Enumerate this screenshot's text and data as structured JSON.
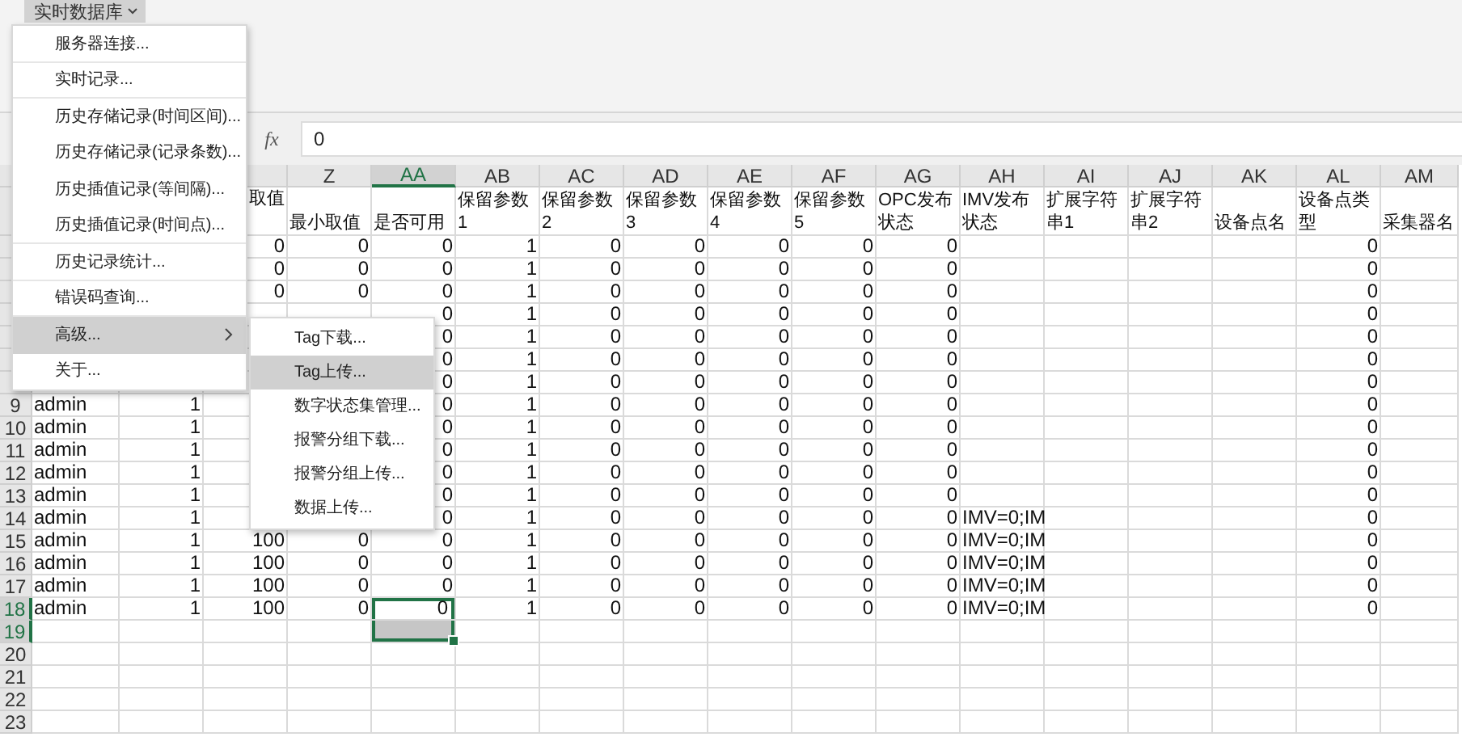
{
  "toolbar": {
    "menu_button": "实时数据库"
  },
  "formula_bar": {
    "fx_label": "fx",
    "value": "0"
  },
  "sheet": {
    "column_headers": [
      {
        "letter": "Z",
        "selected": false
      },
      {
        "letter": "AA",
        "selected": true
      },
      {
        "letter": "AB",
        "selected": false
      },
      {
        "letter": "AC",
        "selected": false
      },
      {
        "letter": "AD",
        "selected": false
      },
      {
        "letter": "AE",
        "selected": false
      },
      {
        "letter": "AF",
        "selected": false
      },
      {
        "letter": "AG",
        "selected": false
      },
      {
        "letter": "AH",
        "selected": false
      },
      {
        "letter": "AI",
        "selected": false
      },
      {
        "letter": "AJ",
        "selected": false
      },
      {
        "letter": "AK",
        "selected": false
      },
      {
        "letter": "AL",
        "selected": false
      },
      {
        "letter": "AM",
        "selected": false
      }
    ],
    "rows": [
      {
        "kind": "header",
        "selected": false,
        "cells": [
          null,
          null,
          "取值",
          "最小取值",
          "是否可用",
          "保留参数1",
          "保留参数2",
          "保留参数3",
          "保留参数4",
          "保留参数5",
          "OPC发布状态",
          "IMV发布状态",
          "扩展字符串1",
          "扩展字符串2",
          "设备点名",
          "设备点类型",
          "采集器名"
        ]
      },
      {
        "kind": "data",
        "selected": false,
        "cells": [
          null,
          null,
          "0",
          "0",
          "0",
          "1",
          "0",
          "0",
          "0",
          "0",
          "0",
          null,
          null,
          null,
          null,
          "0",
          null
        ]
      },
      {
        "kind": "data",
        "selected": false,
        "cells": [
          null,
          null,
          "0",
          "0",
          "0",
          "1",
          "0",
          "0",
          "0",
          "0",
          "0",
          null,
          null,
          null,
          null,
          "0",
          null
        ]
      },
      {
        "kind": "data",
        "selected": false,
        "cells": [
          null,
          null,
          "0",
          "0",
          "0",
          "1",
          "0",
          "0",
          "0",
          "0",
          "0",
          null,
          null,
          null,
          null,
          "0",
          null
        ]
      },
      {
        "kind": "data",
        "selected": false,
        "cells": [
          null,
          null,
          null,
          null,
          "0",
          "1",
          "0",
          "0",
          "0",
          "0",
          "0",
          null,
          null,
          null,
          null,
          "0",
          null
        ]
      },
      {
        "kind": "data",
        "selected": false,
        "cells": [
          null,
          null,
          null,
          null,
          "0",
          "1",
          "0",
          "0",
          "0",
          "0",
          "0",
          null,
          null,
          null,
          null,
          "0",
          null
        ]
      },
      {
        "kind": "data",
        "selected": false,
        "cells": [
          null,
          null,
          null,
          null,
          "0",
          "1",
          "0",
          "0",
          "0",
          "0",
          "0",
          null,
          null,
          null,
          null,
          "0",
          null
        ]
      },
      {
        "kind": "data",
        "selected": false,
        "cells": [
          null,
          null,
          null,
          null,
          "0",
          "1",
          "0",
          "0",
          "0",
          "0",
          "0",
          null,
          null,
          null,
          null,
          "0",
          null
        ]
      },
      {
        "kind": "data",
        "number": "9",
        "selected": false,
        "cells": [
          "admin",
          "1",
          null,
          null,
          "0",
          "1",
          "0",
          "0",
          "0",
          "0",
          "0",
          null,
          null,
          null,
          null,
          "0",
          null
        ]
      },
      {
        "kind": "data",
        "number": "10",
        "selected": false,
        "cells": [
          "admin",
          "1",
          null,
          null,
          "0",
          "1",
          "0",
          "0",
          "0",
          "0",
          "0",
          null,
          null,
          null,
          null,
          "0",
          null
        ]
      },
      {
        "kind": "data",
        "number": "11",
        "selected": false,
        "cells": [
          "admin",
          "1",
          null,
          null,
          "0",
          "1",
          "0",
          "0",
          "0",
          "0",
          "0",
          null,
          null,
          null,
          null,
          "0",
          null
        ]
      },
      {
        "kind": "data",
        "number": "12",
        "selected": false,
        "cells": [
          "admin",
          "1",
          null,
          null,
          "0",
          "1",
          "0",
          "0",
          "0",
          "0",
          "0",
          null,
          null,
          null,
          null,
          "0",
          null
        ]
      },
      {
        "kind": "data",
        "number": "13",
        "selected": false,
        "cells": [
          "admin",
          "1",
          null,
          null,
          "0",
          "1",
          "0",
          "0",
          "0",
          "0",
          "0",
          null,
          null,
          null,
          null,
          "0",
          null
        ]
      },
      {
        "kind": "data",
        "number": "14",
        "selected": false,
        "cells": [
          "admin",
          "1",
          null,
          null,
          "0",
          "1",
          "0",
          "0",
          "0",
          "0",
          "0",
          "IMV=0;IM",
          null,
          null,
          null,
          "0",
          null
        ]
      },
      {
        "kind": "data",
        "number": "15",
        "selected": false,
        "cells": [
          "admin",
          "1",
          "100",
          "0",
          "0",
          "1",
          "0",
          "0",
          "0",
          "0",
          "0",
          "IMV=0;IM",
          null,
          null,
          null,
          "0",
          null
        ]
      },
      {
        "kind": "data",
        "number": "16",
        "selected": false,
        "cells": [
          "admin",
          "1",
          "100",
          "0",
          "0",
          "1",
          "0",
          "0",
          "0",
          "0",
          "0",
          "IMV=0;IM",
          null,
          null,
          null,
          "0",
          null
        ]
      },
      {
        "kind": "data",
        "number": "17",
        "selected": false,
        "cells": [
          "admin",
          "1",
          "100",
          "0",
          "0",
          "1",
          "0",
          "0",
          "0",
          "0",
          "0",
          "IMV=0;IM",
          null,
          null,
          null,
          "0",
          null
        ]
      },
      {
        "kind": "data",
        "number": "18",
        "selected": true,
        "cells": [
          "admin",
          "1",
          "100",
          "0",
          "0",
          "1",
          "0",
          "0",
          "0",
          "0",
          "0",
          "IMV=0;IM",
          null,
          null,
          null,
          "0",
          null
        ]
      },
      {
        "kind": "data",
        "number": "19",
        "selected": true
      },
      {
        "kind": "data",
        "number": "20",
        "selected": false
      },
      {
        "kind": "data",
        "number": "21",
        "selected": false
      },
      {
        "kind": "data",
        "number": "22",
        "selected": false
      },
      {
        "kind": "data",
        "number": "23",
        "selected": false
      }
    ]
  },
  "menu": {
    "items": [
      {
        "label": "服务器连接...",
        "highlighted": false,
        "separator_after": true
      },
      {
        "label": "实时记录...",
        "highlighted": false,
        "separator_after": true
      },
      {
        "label": "历史存储记录(时间区间)...",
        "highlighted": false,
        "separator_after": false
      },
      {
        "label": "历史存储记录(记录条数)...",
        "highlighted": false,
        "separator_after": false
      },
      {
        "label": "历史插值记录(等间隔)...",
        "highlighted": false,
        "separator_after": false
      },
      {
        "label": "历史插值记录(时间点)...",
        "highlighted": false,
        "separator_after": true
      },
      {
        "label": "历史记录统计...",
        "highlighted": false,
        "separator_after": true
      },
      {
        "label": "错误码查询...",
        "highlighted": false,
        "separator_after": true
      },
      {
        "label": "高级...",
        "highlighted": true,
        "has_submenu": true,
        "separator_after": false
      },
      {
        "label": "关于...",
        "highlighted": false,
        "separator_after": false
      }
    ]
  },
  "submenu": {
    "items": [
      {
        "label": "Tag下载...",
        "highlighted": false
      },
      {
        "label": "Tag上传...",
        "highlighted": true
      },
      {
        "label": "数字状态集管理...",
        "highlighted": false
      },
      {
        "label": "报警分组下载...",
        "highlighted": false
      },
      {
        "label": "报警分组上传...",
        "highlighted": false
      },
      {
        "label": "数据上传...",
        "highlighted": false
      }
    ]
  }
}
